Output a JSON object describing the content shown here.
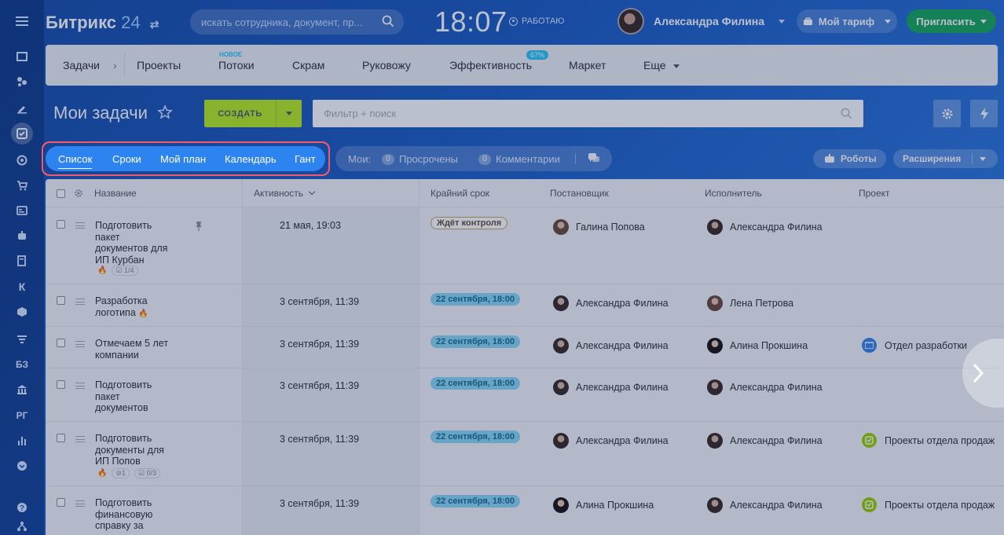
{
  "header": {
    "logo_text": "Битрикс",
    "logo_num": "24",
    "search_placeholder": "искать сотрудника, документ, пр...",
    "clock": "18:07",
    "work_status": "РАБОТАЮ",
    "user_name": "Александра Филина",
    "tariff_label": "Мой тариф",
    "invite_label": "Пригласить"
  },
  "left_rail": {
    "text_items": [
      "К",
      "БЗ",
      "РГ"
    ]
  },
  "topnav": {
    "items": [
      "Задачи",
      "Проекты",
      "Потоки",
      "Скрам",
      "Руковожу",
      "Эффективность",
      "Маркет",
      "Еще"
    ],
    "new_badge": "НОВОЕ",
    "efficiency_badge": "67%"
  },
  "toolbar": {
    "page_title": "Мои задачи",
    "create_label": "СОЗДАТЬ",
    "filter_placeholder": "Фильтр + поиск"
  },
  "views": {
    "items": [
      "Список",
      "Сроки",
      "Мой план",
      "Календарь",
      "Гант"
    ],
    "active": "Список"
  },
  "counters": {
    "label": "Мои:",
    "overdue_count": "0",
    "overdue_label": "Просрочены",
    "comments_count": "0",
    "comments_label": "Комментарии"
  },
  "right_buttons": {
    "robots_label": "Роботы",
    "extensions_label": "Расширения"
  },
  "grid": {
    "columns": [
      "Название",
      "Активность",
      "Крайний срок",
      "Постановщик",
      "Исполнитель",
      "Проект"
    ],
    "rows": [
      {
        "name_lines": [
          "Подготовить",
          "пакет",
          "документов для",
          "ИП Курбан"
        ],
        "meta_checklist": "1/4",
        "activity": "21 мая, 19:03",
        "deadline": "Ждёт контроля",
        "creator": "Галина Попова",
        "responsible": "Александра Филина",
        "project": ""
      },
      {
        "name_lines": [
          "Разработка",
          "логотипа"
        ],
        "activity": "3 сентября, 11:39",
        "deadline": "22 сентября, 18:00",
        "creator": "Александра Филина",
        "responsible": "Лена Петрова",
        "project": ""
      },
      {
        "name_lines": [
          "Отмечаем 5 лет",
          "компании"
        ],
        "activity": "3 сентября, 11:39",
        "deadline": "22 сентября, 18:00",
        "creator": "Александра Филина",
        "responsible": "Алина Прокшина",
        "project": "Отдел разработки"
      },
      {
        "name_lines": [
          "Подготовить",
          "пакет",
          "документов"
        ],
        "activity": "3 сентября, 11:39",
        "deadline": "22 сентября, 18:00",
        "creator": "Александра Филина",
        "responsible": "Александра Филина",
        "project": ""
      },
      {
        "name_lines": [
          "Подготовить",
          "документы для",
          "ИП Попов"
        ],
        "meta_files": "1",
        "meta_checklist": "0/3",
        "activity": "3 сентября, 11:39",
        "deadline": "22 сентября, 18:00",
        "creator": "Александра Филина",
        "responsible": "Александра Филина",
        "project": "Проекты отдела продаж"
      },
      {
        "name_lines": [
          "Подготовить",
          "финансовую",
          "справку за"
        ],
        "activity": "3 сентября, 11:39",
        "deadline": "22 сентября, 18:00",
        "creator": "Алина Прокшина",
        "responsible": "Александра Филина",
        "project": "Проекты отдела продаж"
      }
    ]
  },
  "colors": {
    "accent_green": "#bbed21",
    "invite_green": "#1aa85b",
    "view_blue": "#2d84f0",
    "highlight_red": "#f05a6e",
    "deadline_blue": "#8bd8f4"
  }
}
